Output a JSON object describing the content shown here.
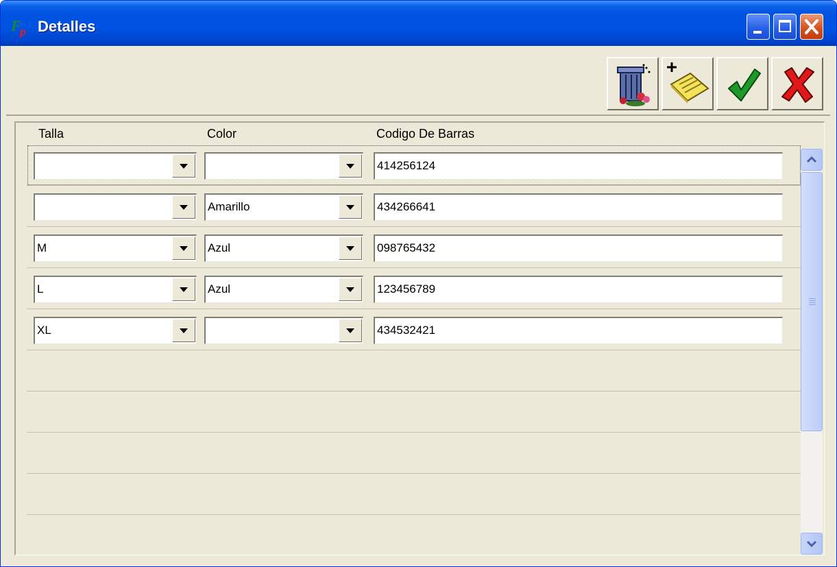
{
  "window": {
    "title": "Detalles"
  },
  "title_buttons": {
    "minimize": "minimize",
    "maximize": "maximize",
    "close": "close"
  },
  "toolbar": [
    {
      "name": "delete-button",
      "icon": "trash-can-icon"
    },
    {
      "name": "add-new-button",
      "icon": "add-notepad-icon"
    },
    {
      "name": "accept-button",
      "icon": "green-checkmark-icon"
    },
    {
      "name": "cancel-button",
      "icon": "red-x-icon"
    }
  ],
  "grid": {
    "headers": {
      "talla": "Talla",
      "color": "Color",
      "codigo": "Codigo De Barras"
    },
    "rows": [
      {
        "talla": "",
        "color": "",
        "codigo": "414256124"
      },
      {
        "talla": "",
        "color": "Amarillo",
        "codigo": "434266641"
      },
      {
        "talla": "M",
        "color": "Azul",
        "codigo": "098765432"
      },
      {
        "talla": "L",
        "color": "Azul",
        "codigo": "123456789"
      },
      {
        "talla": "XL",
        "color": "",
        "codigo": "434532421"
      }
    ]
  },
  "colors": {
    "title_bar": "#0054e3",
    "window_bg": "#ece9d8",
    "close_button": "#d8521f"
  }
}
